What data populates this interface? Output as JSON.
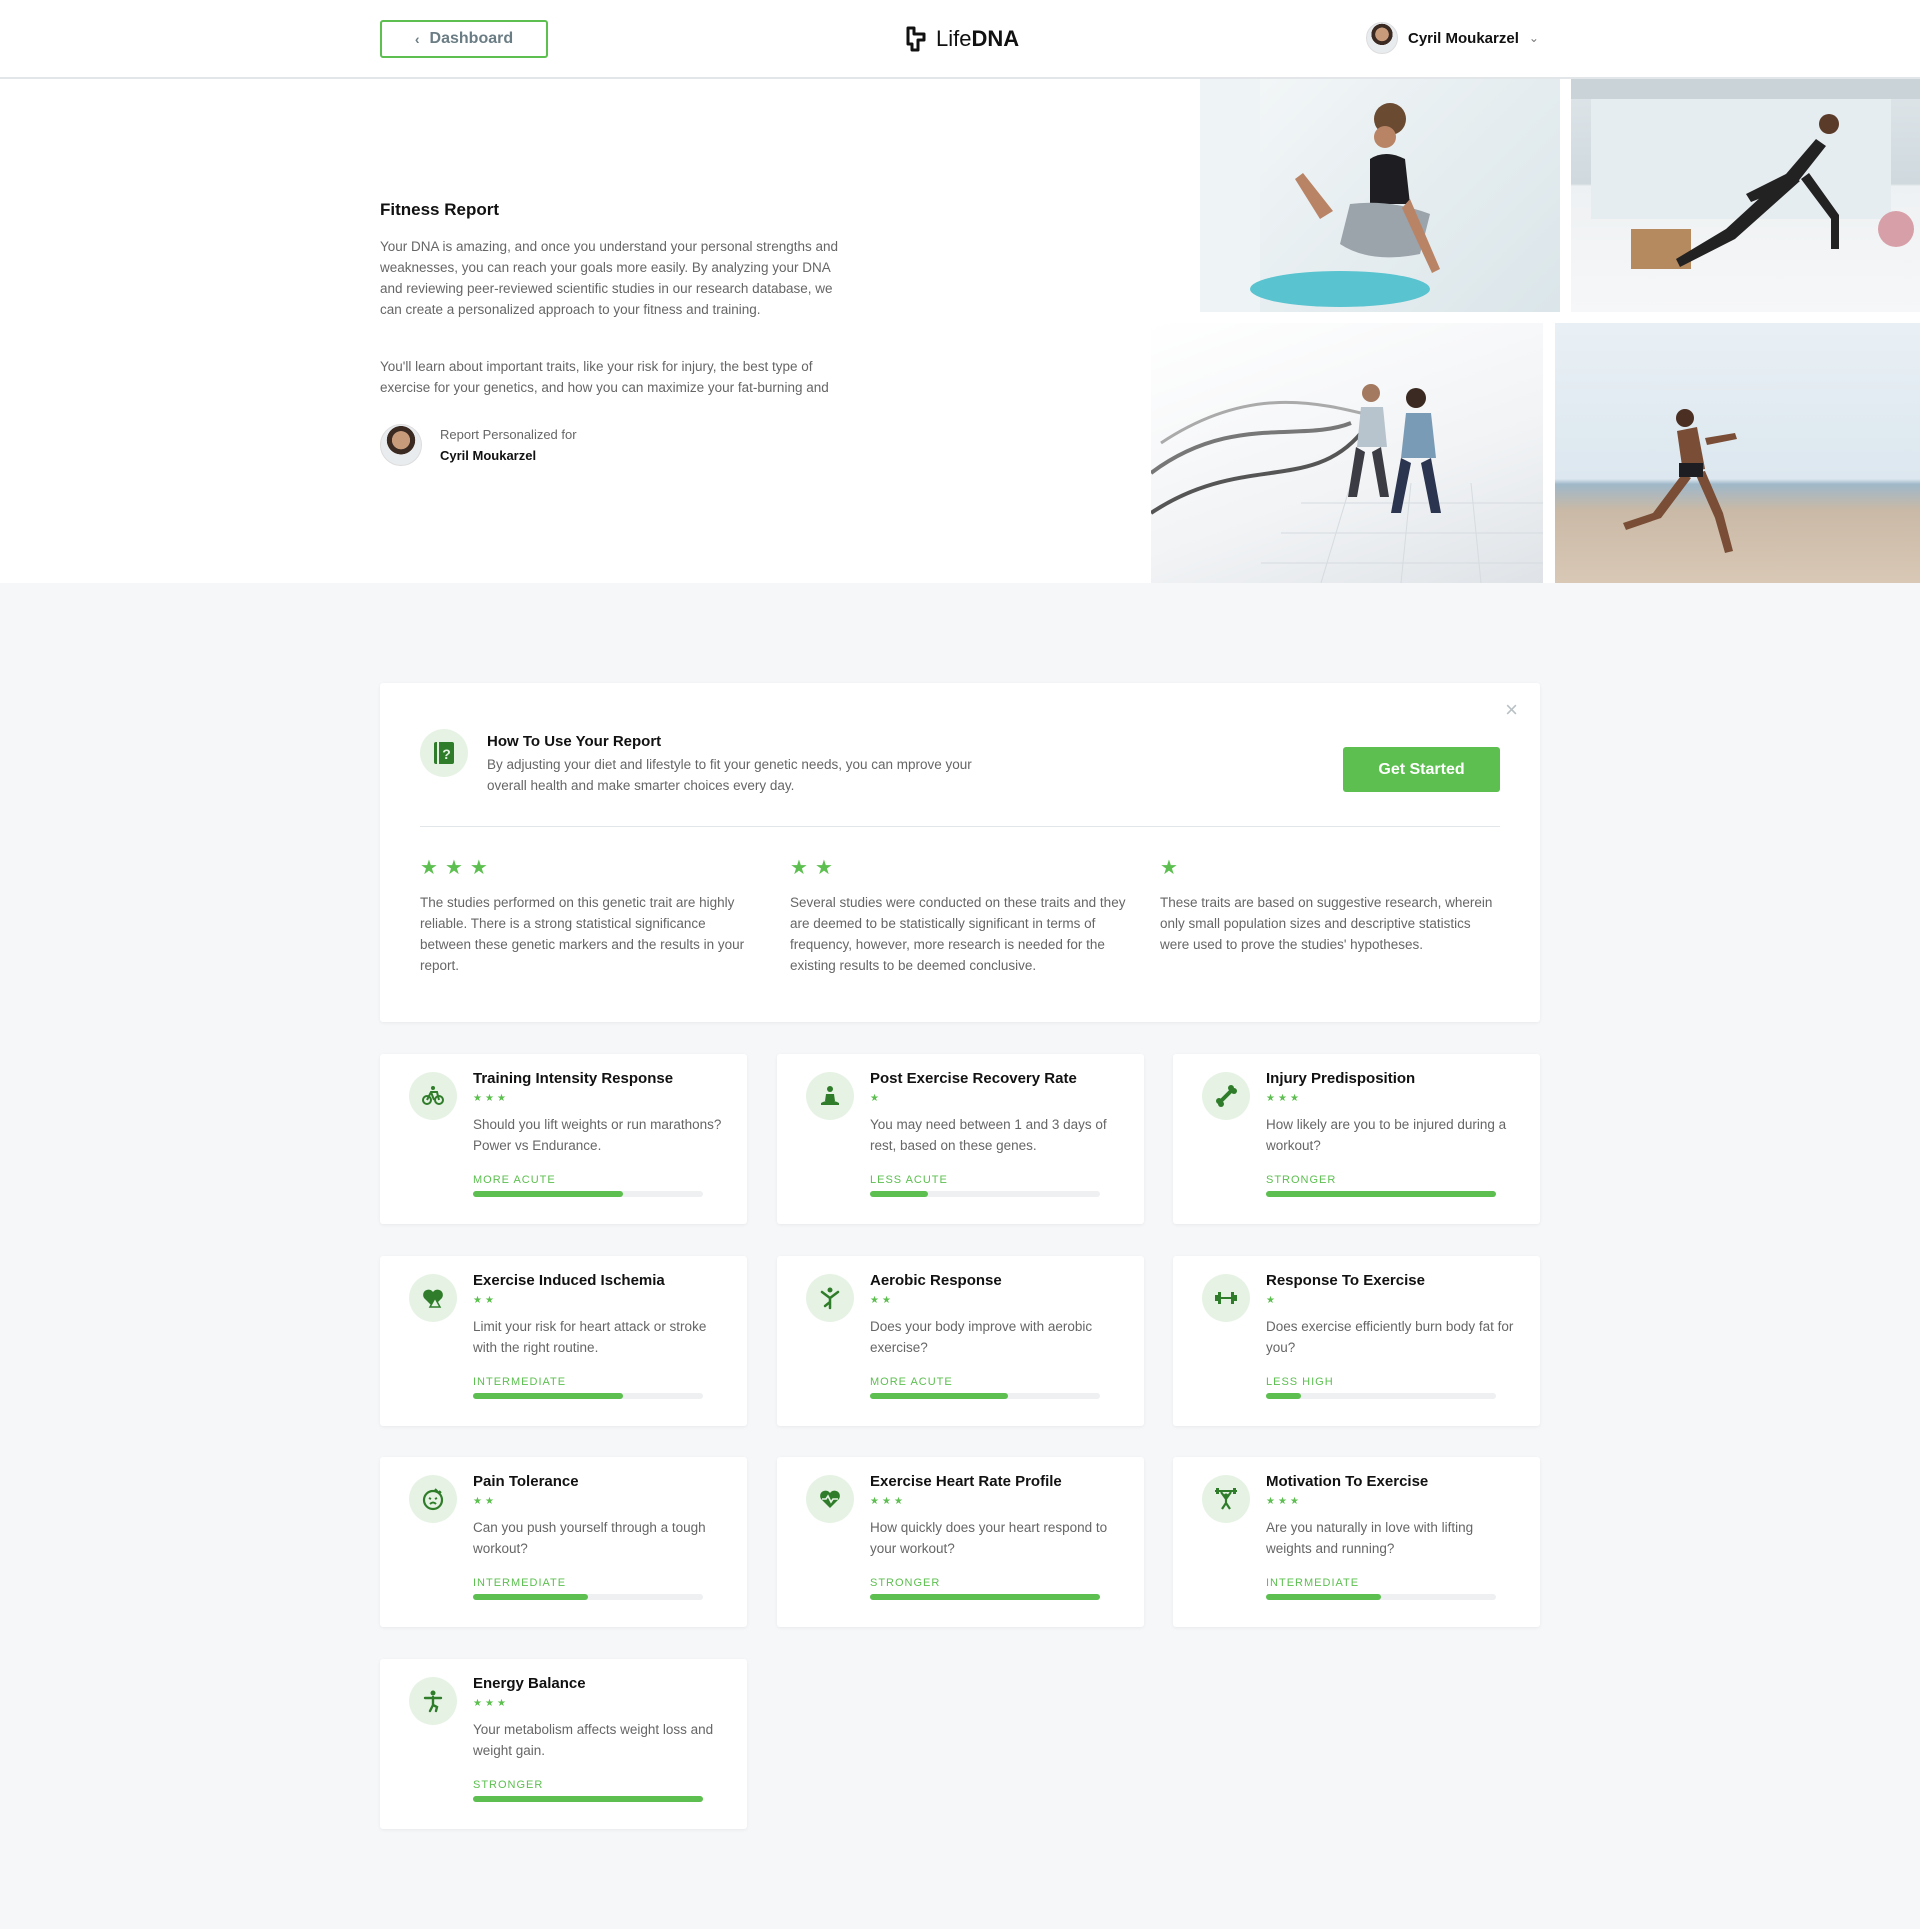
{
  "header": {
    "dashboard_label": "Dashboard",
    "logo_life": "Life",
    "logo_dna": "DNA",
    "user_name": "Cyril Moukarzel"
  },
  "hero": {
    "title": "Fitness Report",
    "p1": "Your DNA is amazing, and once you understand your personal strengths and weaknesses, you can reach your goals more easily. By analyzing your DNA and reviewing peer-reviewed scientific studies in our research database, we can create a personalized approach to your fitness and training.",
    "p2": "You'll learn about important traits, like your risk for injury, the best type of exercise for your genetics, and how you can maximize your fat-burning and",
    "personalized_label": "Report Personalized for",
    "personalized_name": "Cyril Moukarzel"
  },
  "info": {
    "title": "How To Use Your Report",
    "desc": "By adjusting your diet and lifestyle to fit your genetic needs, you can mprove your overall health and make smarter choices every day.",
    "button": "Get Started",
    "close": "×",
    "legend": [
      {
        "stars": 3,
        "text": "The studies performed on this genetic trait are highly reliable. There is a strong statistical significance between these genetic markers and the results in your report."
      },
      {
        "stars": 2,
        "text": "Several studies were conducted on these traits and they are deemed to be statistically significant in terms of frequency, however, more research is needed for the existing results to be deemed conclusive."
      },
      {
        "stars": 1,
        "text": "These traits are based on suggestive research, wherein only small population sizes and descriptive statistics were used to prove the studies' hypotheses."
      }
    ]
  },
  "cards": [
    {
      "title": "Training Intensity Response",
      "stars": 3,
      "desc": "Should you lift weights or run marathons? Power vs Endurance.",
      "label": "MORE ACUTE",
      "level": 0.65,
      "icon": "bicycle-icon"
    },
    {
      "title": "Post Exercise Recovery Rate",
      "stars": 1,
      "desc": "You may need between 1 and 3 days of rest, based on these genes.",
      "label": "LESS ACUTE",
      "level": 0.25,
      "icon": "meditation-icon"
    },
    {
      "title": "Injury Predisposition",
      "stars": 3,
      "desc": "How likely are you to be injured during a workout?",
      "label": "STRONGER",
      "level": 1.0,
      "icon": "bone-icon"
    },
    {
      "title": "Exercise Induced Ischemia",
      "stars": 2,
      "desc": "Limit your risk for heart attack or stroke with the right routine.",
      "label": "INTERMEDIATE",
      "level": 0.65,
      "icon": "heart-warning-icon"
    },
    {
      "title": "Aerobic Response",
      "stars": 2,
      "desc": "Does your body improve with aerobic exercise?",
      "label": "MORE ACUTE",
      "level": 0.6,
      "icon": "aerobic-icon"
    },
    {
      "title": "Response To Exercise",
      "stars": 1,
      "desc": "Does exercise efficiently burn body fat for you?",
      "label": "LESS HIGH",
      "level": 0.15,
      "icon": "dumbbell-icon"
    },
    {
      "title": "Pain Tolerance",
      "stars": 2,
      "desc": "Can you push yourself through a tough workout?",
      "label": "INTERMEDIATE",
      "level": 0.5,
      "icon": "pain-face-icon"
    },
    {
      "title": "Exercise Heart Rate Profile",
      "stars": 3,
      "desc": "How quickly does your heart respond to your workout?",
      "label": "STRONGER",
      "level": 1.0,
      "icon": "heart-pulse-icon"
    },
    {
      "title": "Motivation To Exercise",
      "stars": 3,
      "desc": "Are you naturally in love with lifting weights and running?",
      "label": "INTERMEDIATE",
      "level": 0.5,
      "icon": "weightlifter-icon"
    },
    {
      "title": "Energy Balance",
      "stars": 3,
      "desc": "Your metabolism affects weight loss and weight gain.",
      "label": "STRONGER",
      "level": 1.0,
      "icon": "balance-icon"
    }
  ],
  "colors": {
    "accent": "#5cbf4f",
    "icon_bg": "#e6f3e4",
    "icon_fg": "#2f7d2a"
  }
}
